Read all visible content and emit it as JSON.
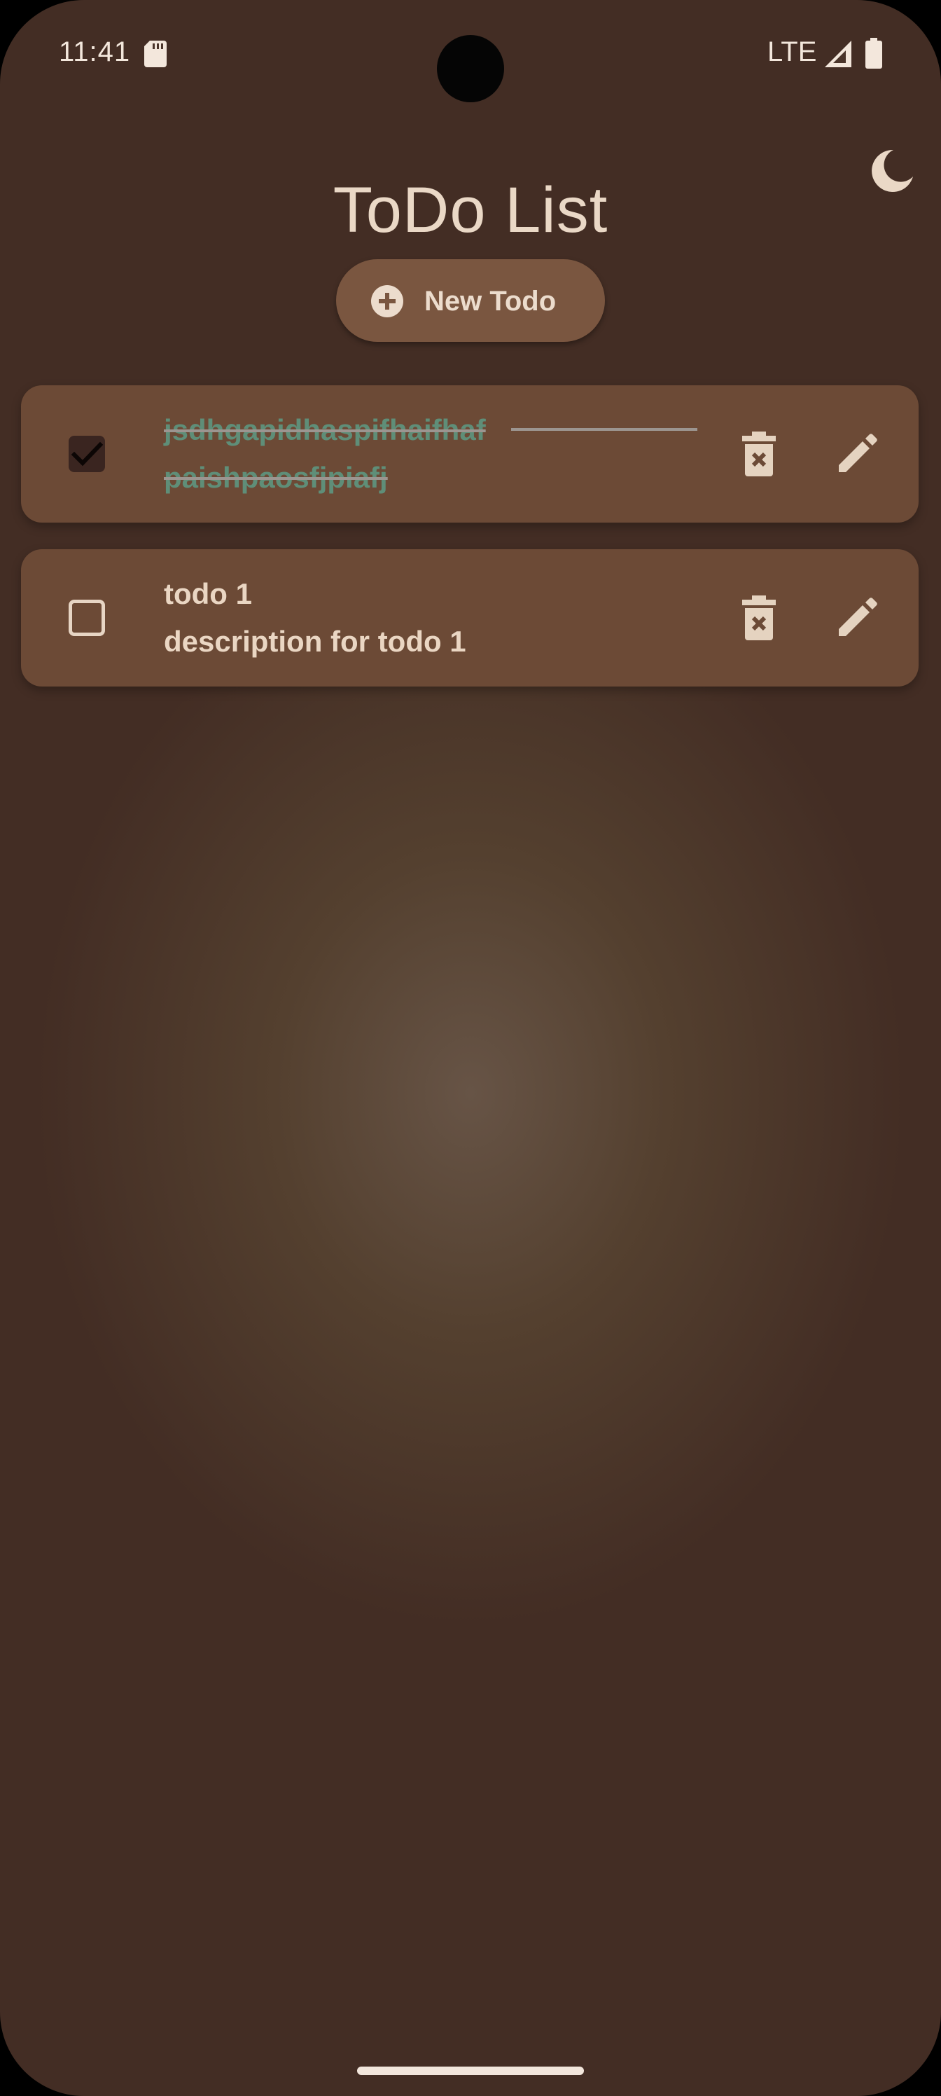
{
  "status_bar": {
    "time": "11:41",
    "network": "LTE"
  },
  "header": {
    "title": "ToDo List",
    "theme_icon": "moon-icon"
  },
  "new_todo_button": {
    "label": "New Todo",
    "icon": "add-circle-icon"
  },
  "todos": [
    {
      "title": "jsdhgapidhaspifhaifhaf",
      "description": "paishpaosfjpiafj",
      "completed": true
    },
    {
      "title": "todo 1",
      "description": "description for todo 1",
      "completed": false
    }
  ],
  "colors": {
    "background": "#432d24",
    "card": "#6c4a36",
    "button": "#7a5640",
    "text": "#ead6c3",
    "completed_text": "#5f8e78"
  }
}
